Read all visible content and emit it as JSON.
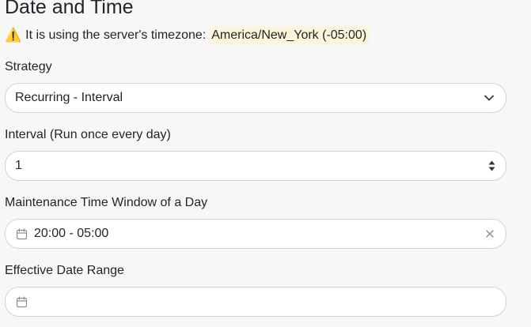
{
  "section": {
    "title": "Date and Time"
  },
  "timezone": {
    "warning_icon": "warning-icon",
    "message": "It is using the server's timezone:",
    "value": "America/New_York (-05:00)"
  },
  "strategy": {
    "label": "Strategy",
    "value": "Recurring - Interval"
  },
  "interval": {
    "label": "Interval (Run once every day)",
    "value": "1"
  },
  "time_window": {
    "label": "Maintenance Time Window of a Day",
    "value": "20:00 - 05:00"
  },
  "date_range": {
    "label": "Effective Date Range",
    "value": ""
  },
  "icons": {
    "chevron": "chevron-down-icon",
    "calendar": "calendar-icon",
    "clear": "close-icon",
    "stepper": "stepper-icon"
  },
  "colors": {
    "highlight": "#fcf5dc",
    "border": "#ced4da",
    "background": "#f7f7f8"
  }
}
